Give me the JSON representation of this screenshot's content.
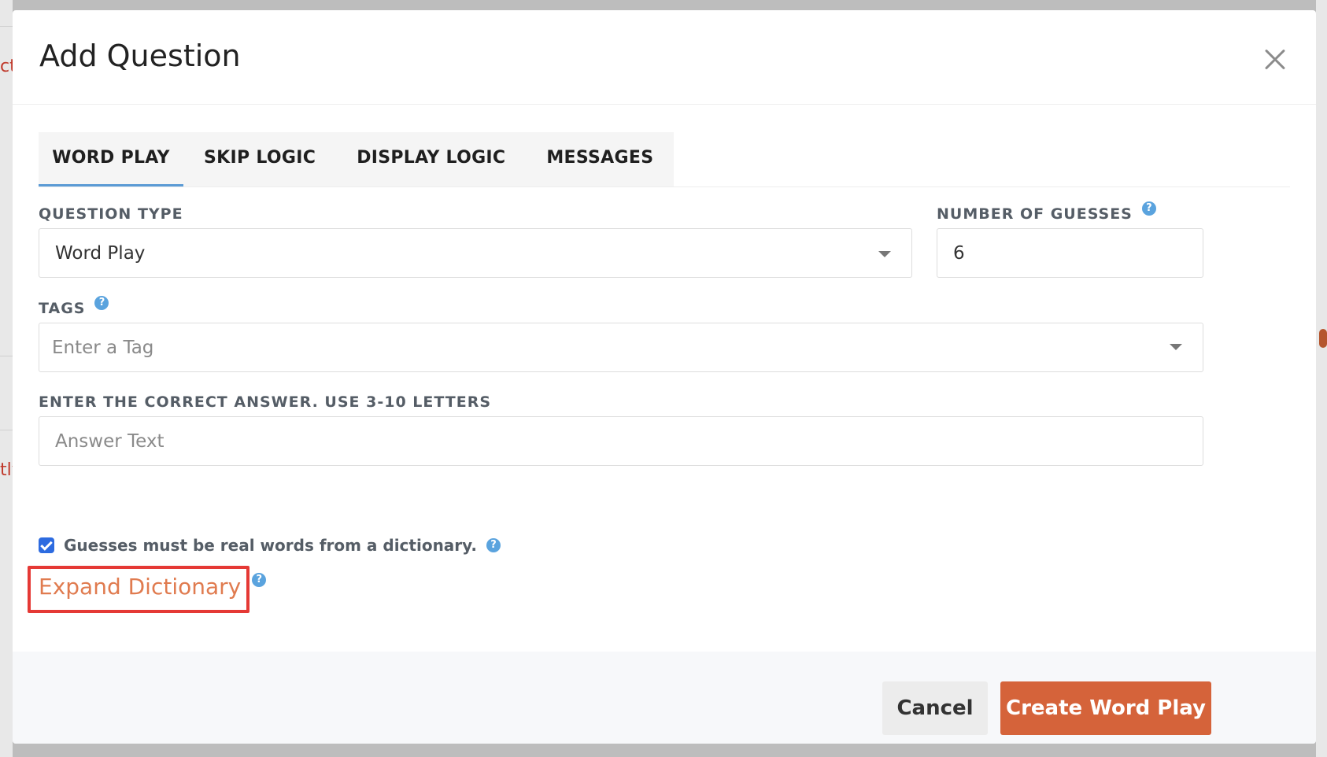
{
  "background": {
    "left_snippets": [
      "ct",
      "tly"
    ]
  },
  "modal": {
    "title": "Add Question",
    "close_icon": "close-icon",
    "tabs": [
      {
        "label": "WORD PLAY",
        "active": true
      },
      {
        "label": "SKIP LOGIC",
        "active": false
      },
      {
        "label": "DISPLAY LOGIC",
        "active": false
      },
      {
        "label": "MESSAGES",
        "active": false
      }
    ]
  },
  "form": {
    "question_type": {
      "label": "QUESTION TYPE",
      "value": "Word Play"
    },
    "number_of_guesses": {
      "label": "NUMBER OF GUESSES",
      "value": "6"
    },
    "tags": {
      "label": "TAGS",
      "placeholder": "Enter a Tag"
    },
    "answer": {
      "label": "ENTER THE CORRECT ANSWER. USE 3-10 LETTERS",
      "placeholder": "Answer Text"
    },
    "dictionary_check": {
      "label": "Guesses must be real words from a dictionary.",
      "checked": true
    },
    "expand_dictionary": {
      "label": "Expand Dictionary"
    },
    "help_glyph": "?"
  },
  "footer": {
    "cancel_label": "Cancel",
    "create_label": "Create Word Play"
  },
  "colors": {
    "tab_active_underline": "#5b9bd5",
    "help_icon": "#5aa3de",
    "checkbox": "#2d6be0",
    "link": "#e07b4f",
    "highlight_box": "#e53935",
    "primary_button": "#d5633a"
  }
}
